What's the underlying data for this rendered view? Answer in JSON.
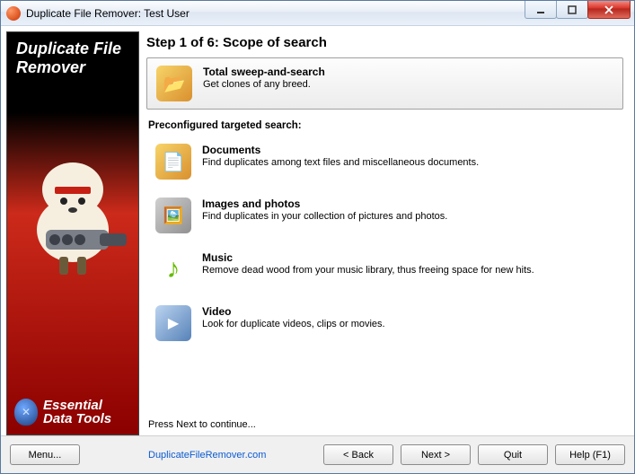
{
  "window": {
    "title": "Duplicate File Remover: Test User"
  },
  "sidebar": {
    "brand_line1": "Duplicate File",
    "brand_line2": "Remover",
    "footer_line1": "Essential",
    "footer_line2": "Data Tools"
  },
  "main": {
    "step_heading": "Step 1 of 6: Scope of search",
    "section_label": "Preconfigured targeted search:",
    "press_next": "Press Next to continue...",
    "options": [
      {
        "title": "Total sweep-and-search",
        "desc": "Get clones of any breed."
      },
      {
        "title": "Documents",
        "desc": "Find duplicates among text files and miscellaneous documents."
      },
      {
        "title": "Images and photos",
        "desc": "Find duplicates in your collection of pictures and photos."
      },
      {
        "title": "Music",
        "desc": "Remove dead wood from your music library, thus freeing space for new hits."
      },
      {
        "title": "Video",
        "desc": "Look for duplicate videos, clips or movies."
      }
    ]
  },
  "footer": {
    "menu": "Menu...",
    "link": "DuplicateFileRemover.com",
    "back": "< Back",
    "next": "Next >",
    "quit": "Quit",
    "help": "Help (F1)"
  }
}
